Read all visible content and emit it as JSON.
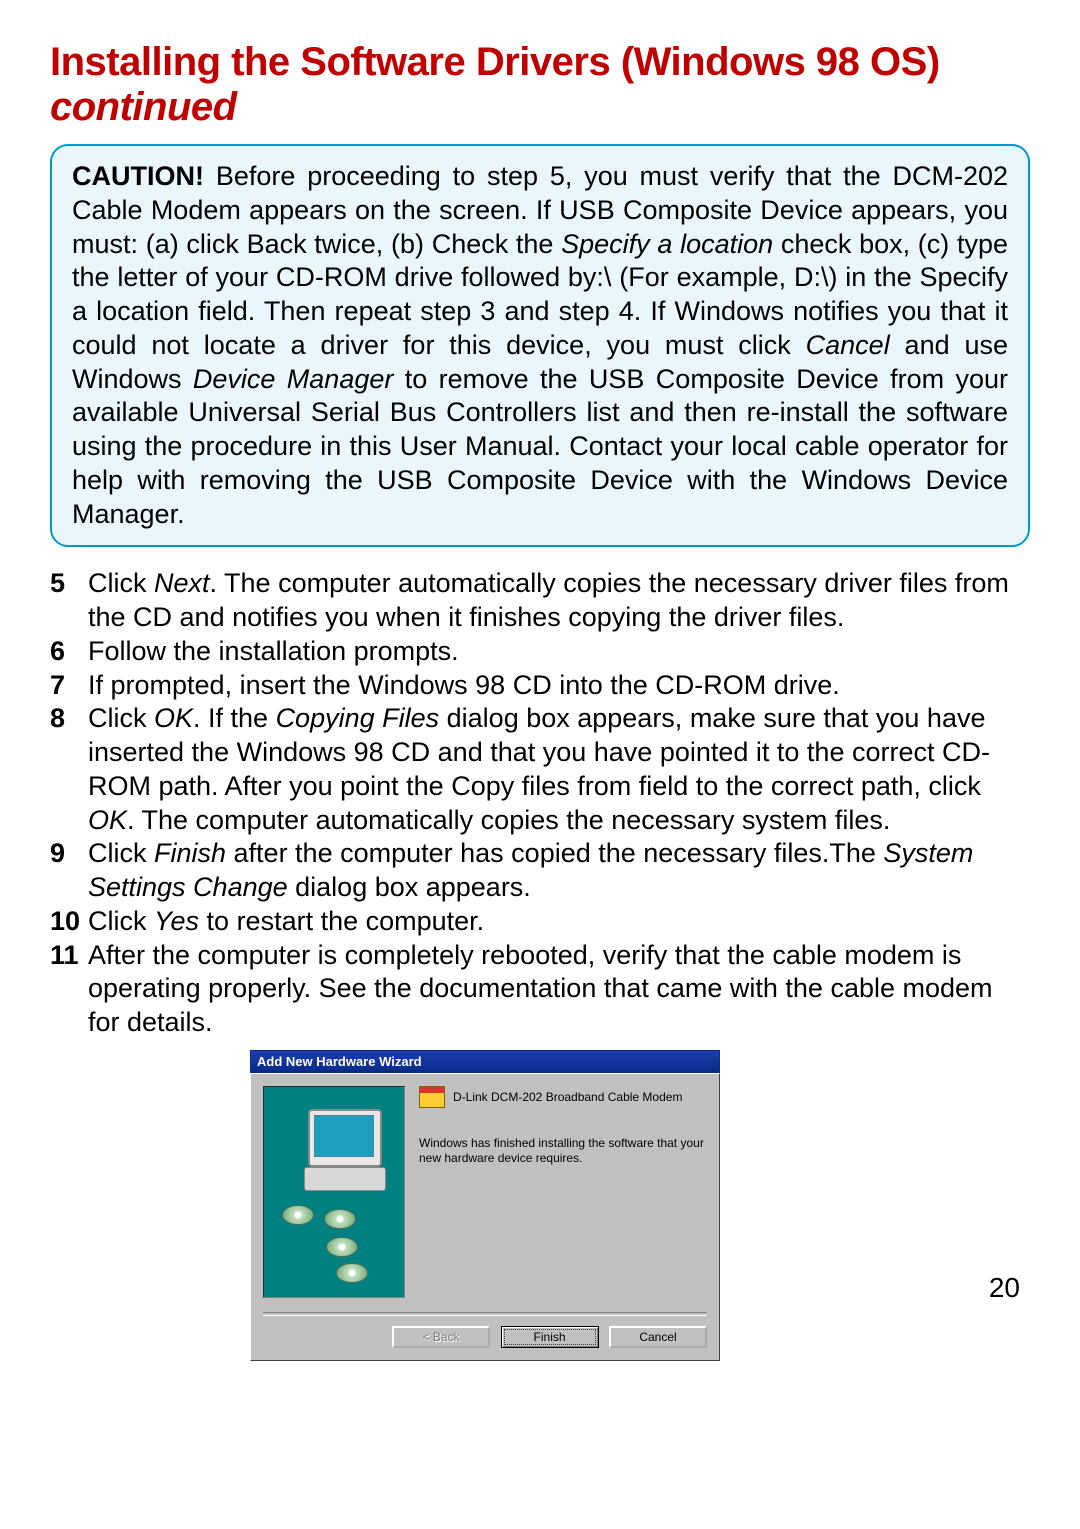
{
  "title_main": "Installing the Software Drivers (Windows 98 OS)",
  "title_continued": "continued",
  "caution": {
    "label": "CAUTION!",
    "text_before_specify": " Before proceeding to step 5, you must verify that the DCM-202 Cable Modem appears on the screen. If USB Composite Device appears, you must: (a) click Back twice, (b) Check the ",
    "specify_italic": "Specify a location",
    "text_middle": " check box, (c) type the letter of your CD-ROM drive followed by:\\ (For example, D:\\) in the Specify a location field. Then repeat step 3 and step 4. If Windows notifies you that it could not locate a driver for this device, you must click ",
    "cancel_italic": "Cancel",
    "text_after_cancel": " and use Windows ",
    "devmgr_italic": "Device Manager",
    "text_end": " to remove the USB Composite Device from your available Universal Serial Bus Controllers list and then re-install the software using the procedure in this User Manual. Contact your local cable operator for help with removing the USB Composite Device with the Windows Device Manager."
  },
  "steps": [
    {
      "num": "5",
      "pre": "Click ",
      "it1": "Next",
      "post": ". The computer automatically copies the necessary driver files from the CD and notifies you when it finishes copying the driver files."
    },
    {
      "num": "6",
      "pre": "Follow the installation prompts.",
      "it1": "",
      "post": ""
    },
    {
      "num": "7",
      "pre": "If prompted, insert the Windows 98 CD into the CD-ROM drive.",
      "it1": "",
      "post": ""
    },
    {
      "num": "8",
      "pre": "Click ",
      "it1": "OK",
      "mid1": ". If the ",
      "it2": "Copying Files",
      "mid2": " dialog box appears, make sure that you have inserted the Windows 98 CD and that you have pointed it to the correct CD-ROM path. After you point the Copy files from field to the correct path, click ",
      "it3": "OK",
      "post": ". The computer automatically copies the necessary system files."
    },
    {
      "num": "9",
      "pre": "Click ",
      "it1": "Finish",
      "mid1": " after the computer has copied the necessary files.The ",
      "it2": "System Settings Change",
      "post": " dialog box appears."
    },
    {
      "num": "10",
      "pre": "Click ",
      "it1": "Yes",
      "post": " to restart the computer."
    },
    {
      "num": "11",
      "pre": "After the computer is completely rebooted, verify that the cable modem is operating properly. See the documentation that came with the cable modem for details.",
      "it1": "",
      "post": ""
    }
  ],
  "dialog": {
    "title": "Add New Hardware Wizard",
    "device_name": "D-Link DCM-202 Broadband Cable Modem",
    "message": "Windows has finished installing the software that your new hardware device requires.",
    "buttons": {
      "back": "< Back",
      "finish": "Finish",
      "cancel": "Cancel"
    }
  },
  "page_number": "20"
}
